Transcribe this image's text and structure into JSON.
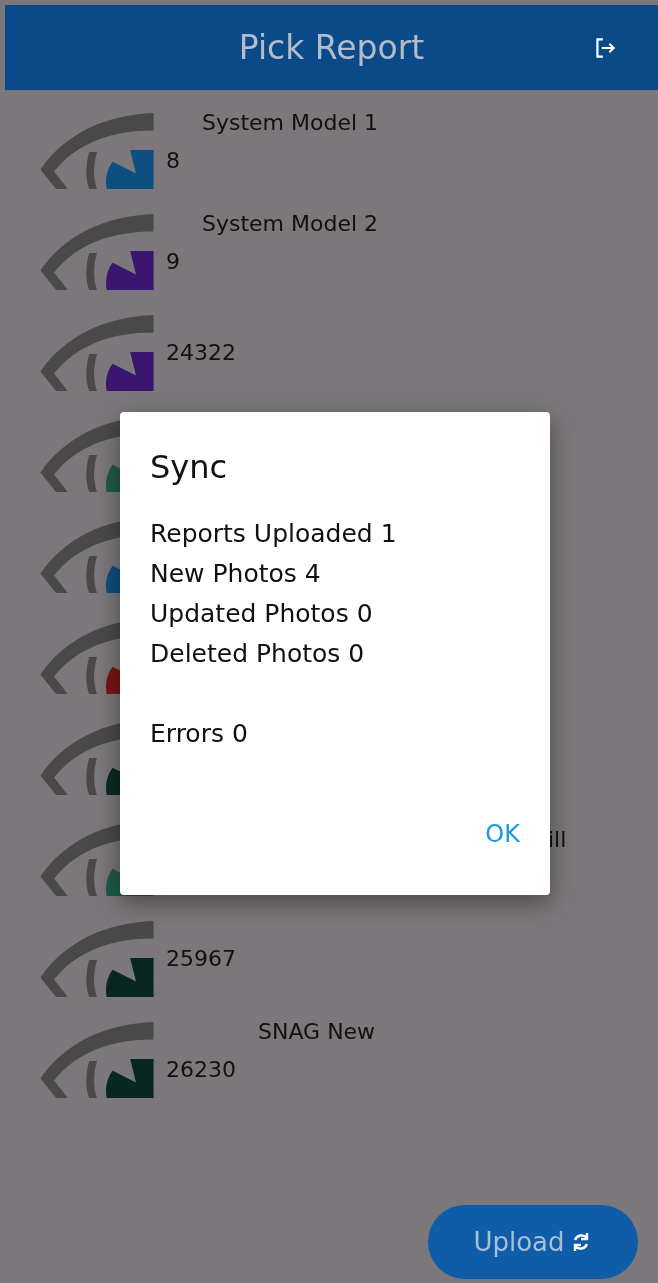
{
  "app_bar": {
    "title": "Pick Report"
  },
  "reports": [
    {
      "number": "8",
      "title": "System Model 1",
      "color": "#0d4f80"
    },
    {
      "number": "9",
      "title": "System Model 2",
      "color": "#3a1670"
    },
    {
      "number": "24322",
      "color": "#3a1670"
    },
    {
      "color": "#1f5a48"
    },
    {
      "color": "#0d4f80"
    },
    {
      "color": "#7a1515"
    },
    {
      "color": "#0a2a24"
    },
    {
      "title": "ill",
      "color": "#1f5a48"
    },
    {
      "number": "25967",
      "color": "#08281f"
    },
    {
      "number": "26230",
      "title": "SNAG New",
      "color": "#08281f"
    }
  ],
  "dialog": {
    "title": "Sync",
    "summary": [
      "Reports Uploaded 1",
      "New Photos 4",
      "Updated Photos 0",
      "Deleted Photos 0"
    ],
    "errors": "Errors 0",
    "button": "OK"
  },
  "upload_button": {
    "label": "Upload"
  }
}
